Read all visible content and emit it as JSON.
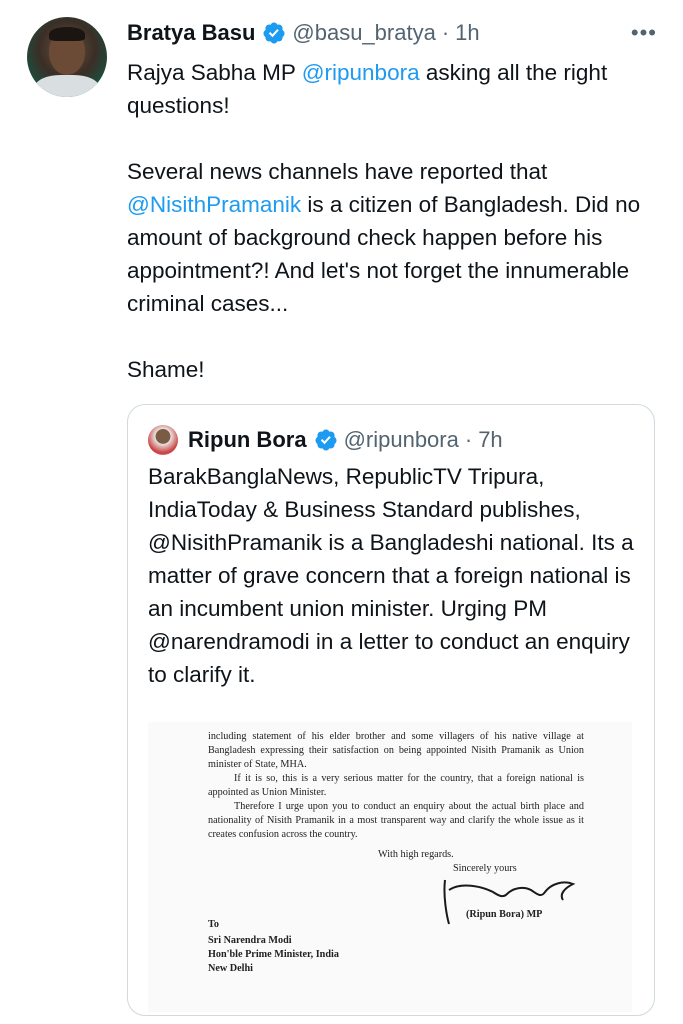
{
  "tweet": {
    "author_name": "Bratya Basu",
    "handle": "@basu_bratya",
    "separator": "·",
    "time": "1h",
    "more": "•••",
    "text": {
      "l1_pre": "Rajya Sabha MP ",
      "l1_mention": "@ripunbora",
      "l1_post": " asking all the right questions!",
      "p2_pre": "Several news channels have reported that ",
      "p2_mention": "@NisithPramanik",
      "p2_post": " is a citizen of Bangladesh. Did no amount of background check happen before his appointment?! And let's not forget the innumerable criminal cases...",
      "p3": "Shame!"
    }
  },
  "quoted_tweet": {
    "author_name": "Ripun Bora",
    "handle": "@ripunbora",
    "separator": "·",
    "time": "7h",
    "text": "BarakBanglaNews, RepublicTV Tripura, IndiaToday & Business Standard publishes, @NisithPramanik is a Bangladeshi national. Its a matter of grave concern that a foreign national is an incumbent union minister. Urging PM @narendramodi in a letter to conduct an enquiry to clarify it.",
    "letter": {
      "para1": "including statement of his elder brother and some villagers of his native village at Bangladesh expressing their satisfaction on being appointed Nisith Pramanik as Union minister of State, MHA.",
      "para2": "If it is so, this is a very serious matter for the country, that a foreign national is appointed as Union Minister.",
      "para3": "Therefore I urge upon you to conduct an enquiry about the actual birth place and nationality of Nisith Pramanik in a most transparent way and clarify the whole issue as it creates confusion across the country.",
      "regards": "With high regards.",
      "sincerely": "Sincerely yours",
      "signatory": "(Ripun Bora) MP",
      "to": "To",
      "addr1": "Sri Narendra Modi",
      "addr2": "Hon'ble Prime Minister, India",
      "addr3": "New Delhi"
    }
  },
  "colors": {
    "link": "#1d9bf0",
    "secondary_text": "#536471",
    "verified": "#1d9bf0"
  }
}
